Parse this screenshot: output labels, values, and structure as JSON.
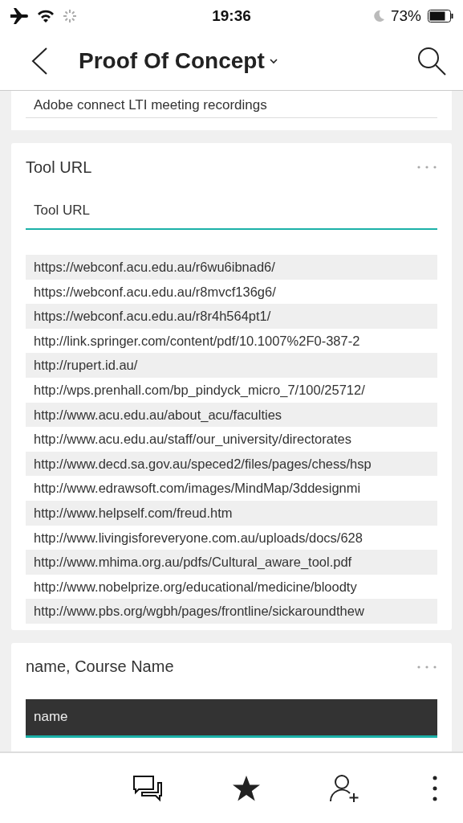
{
  "status_bar": {
    "time": "19:36",
    "battery": "73%"
  },
  "nav": {
    "title": "Proof Of Concept"
  },
  "cards": [
    {
      "kind": "value",
      "value": "Adobe connect LTI meeting recordings"
    },
    {
      "kind": "list",
      "title": "Tool URL",
      "field": {
        "label": "Tool URL"
      },
      "items": [
        "https://webconf.acu.edu.au/r6wu6ibnad6/",
        "https://webconf.acu.edu.au/r8mvcf136g6/",
        "https://webconf.acu.edu.au/r8r4h564pt1/",
        "http://link.springer.com/content/pdf/10.1007%2F0-387-2",
        "http://rupert.id.au/",
        "http://wps.prenhall.com/bp_pindyck_micro_7/100/25712/",
        "http://www.acu.edu.au/about_acu/faculties",
        "http://www.acu.edu.au/staff/our_university/directorates",
        "http://www.decd.sa.gov.au/speced2/files/pages/chess/hsp",
        "http://www.edrawsoft.com/images/MindMap/3ddesignmi",
        "http://www.helpself.com/freud.htm",
        "http://www.livingisforeveryone.com.au/uploads/docs/628",
        "http://www.mhima.org.au/pdfs/Cultural_aware_tool.pdf",
        "http://www.nobelprize.org/educational/medicine/bloodty",
        "http://www.pbs.org/wgbh/pages/frontline/sickaroundthew"
      ]
    },
    {
      "kind": "dark_field",
      "title": "name, Course Name",
      "field": {
        "value": "name"
      }
    }
  ]
}
